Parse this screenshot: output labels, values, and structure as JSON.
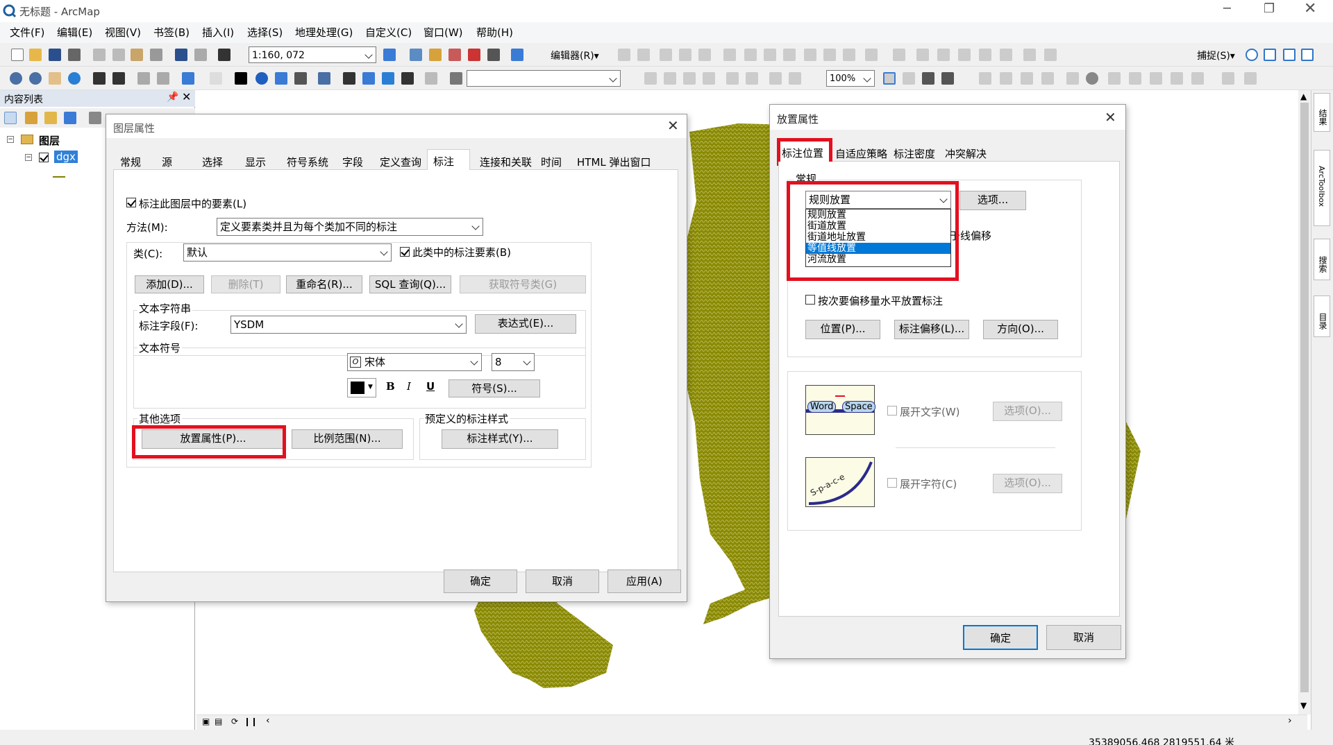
{
  "window": {
    "title": "无标题 - ArcMap"
  },
  "menus": [
    "文件(F)",
    "编辑(E)",
    "视图(V)",
    "书签(B)",
    "插入(I)",
    "选择(S)",
    "地理处理(G)",
    "自定义(C)",
    "窗口(W)",
    "帮助(H)"
  ],
  "toolbar": {
    "scale": "1:160, 072",
    "editor": "编辑器(R)▾",
    "zoom": "100%",
    "snap": "捕捉(S)▾"
  },
  "toc": {
    "title": "内容列表",
    "group": "图层",
    "layer": "dgx"
  },
  "right_panel": {
    "tabs": [
      "结果",
      "ArcToolbox",
      "搜索",
      "目录"
    ]
  },
  "status": {
    "coords": "35389056.468  2819551.64 米"
  },
  "layer_props": {
    "title": "图层属性",
    "tabs": [
      "常规",
      "源",
      "选择",
      "显示",
      "符号系统",
      "字段",
      "定义查询",
      "标注",
      "连接和关联",
      "时间",
      "HTML 弹出窗口"
    ],
    "label_check": "标注此图层中的要素(L)",
    "method_label": "方法(M):",
    "method_value": "定义要素类并且为每个类加不同的标注",
    "class_label": "类(C):",
    "class_value": "默认",
    "class_check": "此类中的标注要素(B)",
    "btn_add": "添加(D)...",
    "btn_delete": "删除(T)",
    "btn_rename": "重命名(R)...",
    "btn_sql": "SQL 查询(Q)...",
    "btn_getclass": "获取符号类(G)",
    "text_string": "文本字符串",
    "field_label": "标注字段(F):",
    "field_value": "YSDM",
    "btn_expr": "表达式(E)...",
    "text_symbol": "文本符号",
    "font": "宋体",
    "size": "8",
    "bold": "B",
    "italic": "I",
    "underline": "U",
    "btn_symbol": "符号(S)...",
    "other_options": "其他选项",
    "btn_placement": "放置属性(P)...",
    "btn_scale": "比例范围(N)...",
    "predef": "预定义的标注样式",
    "btn_style": "标注样式(Y)...",
    "ok": "确定",
    "cancel": "取消",
    "apply": "应用(A)"
  },
  "placement": {
    "title": "放置属性",
    "tabs": [
      "标注位置",
      "自适应策略",
      "标注密度",
      "冲突解决"
    ],
    "general": "常规",
    "select_value": "规则放置",
    "options": [
      "规则放置",
      "街道放置",
      "街道地址放置",
      "等值线放置",
      "河流放置"
    ],
    "selected_index": 3,
    "btn_options": "选项...",
    "offset_text": "于线偏移",
    "horiz_check": "按次要偏移量水平放置标注",
    "btn_position": "位置(P)...",
    "btn_offset": "标注偏移(L)...",
    "btn_direction": "方向(O)...",
    "word_sample": [
      "Word",
      "Space"
    ],
    "spread_words": "展开文字(W)",
    "spread_chars": "展开字符(C)",
    "btn_opt_w": "选项(O)...",
    "btn_opt_c": "选项(O)...",
    "curve_sample": "S-p-a-c-e",
    "ok": "确定",
    "cancel": "取消"
  }
}
